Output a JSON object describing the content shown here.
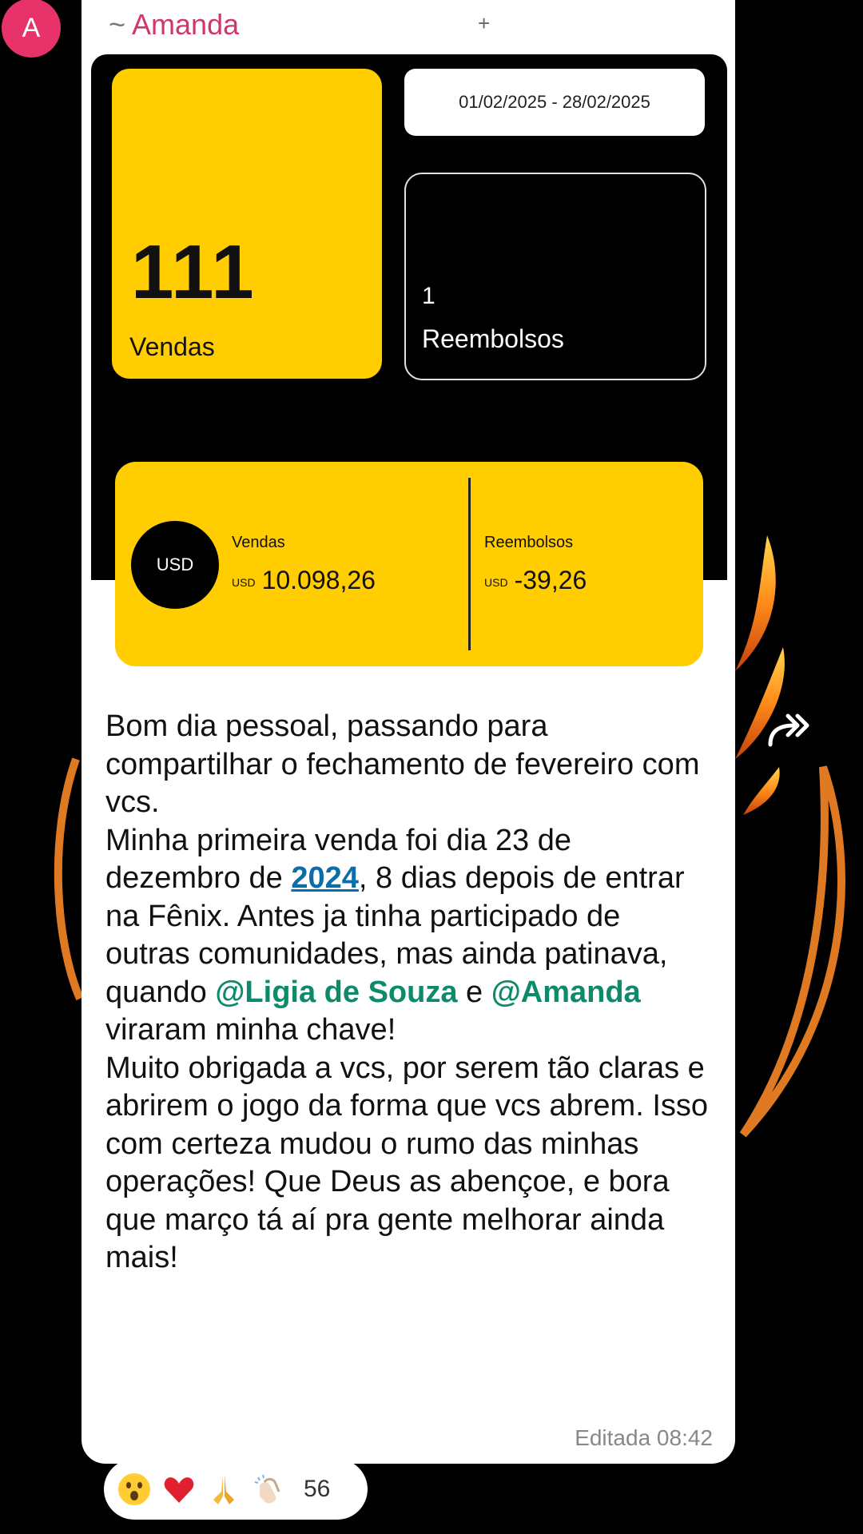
{
  "avatar": {
    "initial": "A",
    "color": "#e8336a"
  },
  "message": {
    "sender_prefix": "~",
    "sender_name": "Amanda",
    "plus": "+",
    "image": {
      "date_range": "01/02/2025 - 28/02/2025",
      "sales_count": "111",
      "sales_label": "Vendas",
      "refunds_count": "1",
      "refunds_label": "Reembolsos",
      "currency_badge": "USD",
      "total_sales_label": "Vendas",
      "total_sales_currency": "USD",
      "total_sales_value": "10.098,26",
      "total_refunds_label": "Reembolsos",
      "total_refunds_currency": "USD",
      "total_refunds_value": "-39,26",
      "accent": "#ffcd00"
    },
    "text": {
      "p1": "Bom dia pessoal, passando para compartilhar o fechamento de fevereiro com vcs.",
      "p2_a": "Minha primeira venda foi dia 23 de dezembro de ",
      "p2_link": "2024",
      "p2_b": ", 8 dias depois de entrar na Fênix. Antes ja tinha participado de outras comunidades, mas ainda patinava, quando ",
      "p2_mention1": "@Ligia de Souza",
      "p2_c": " e ",
      "p2_mention2": "@Amanda",
      "p2_d": " viraram minha chave!",
      "p3": "Muito obrigada a vcs, por serem tão claras e abrirem o jogo da forma que vcs abrem. Isso com certeza mudou o rumo das minhas operações! Que Deus as abençoe, e bora que março tá aí pra gente melhorar ainda mais!"
    },
    "edited_label": "Editada 08:42",
    "reactions": {
      "icons": [
        "surprised-face-icon",
        "red-heart-icon",
        "folded-hands-icon",
        "clapping-hands-icon"
      ],
      "count": "56"
    }
  }
}
